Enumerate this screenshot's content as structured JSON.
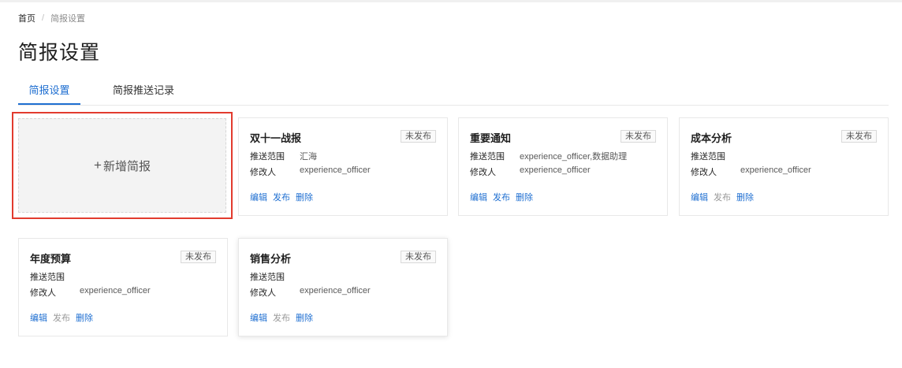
{
  "breadcrumb": {
    "home": "首页",
    "separator": "/",
    "current": "简报设置"
  },
  "page_title": "简报设置",
  "tabs": [
    {
      "label": "简报设置",
      "active": true
    },
    {
      "label": "简报推送记录",
      "active": false
    }
  ],
  "add_card": {
    "plus": "+",
    "label": "新增简报"
  },
  "labels": {
    "scope": "推送范围",
    "editor": "修改人"
  },
  "cards": [
    {
      "title": "双十一战报",
      "status": "未发布",
      "scope": "汇海",
      "editor": "experience_officer",
      "edit": "编辑",
      "publish": "发布",
      "delete": "删除",
      "publish_enabled": true
    },
    {
      "title": "重要通知",
      "status": "未发布",
      "scope": "experience_officer,数据助理",
      "editor": "experience_officer",
      "edit": "编辑",
      "publish": "发布",
      "delete": "删除",
      "publish_enabled": true
    },
    {
      "title": "成本分析",
      "status": "未发布",
      "scope": "",
      "editor": "experience_officer",
      "edit": "编辑",
      "publish": "发布",
      "delete": "删除",
      "publish_enabled": false
    },
    {
      "title": "年度预算",
      "status": "未发布",
      "scope": "",
      "editor": "experience_officer",
      "edit": "编辑",
      "publish": "发布",
      "delete": "删除",
      "publish_enabled": false
    },
    {
      "title": "销售分析",
      "status": "未发布",
      "scope": "",
      "editor": "experience_officer",
      "edit": "编辑",
      "publish": "发布",
      "delete": "删除",
      "publish_enabled": false
    }
  ],
  "colors": {
    "accent": "#1f6fd1",
    "highlight_border": "#e23b2e"
  }
}
